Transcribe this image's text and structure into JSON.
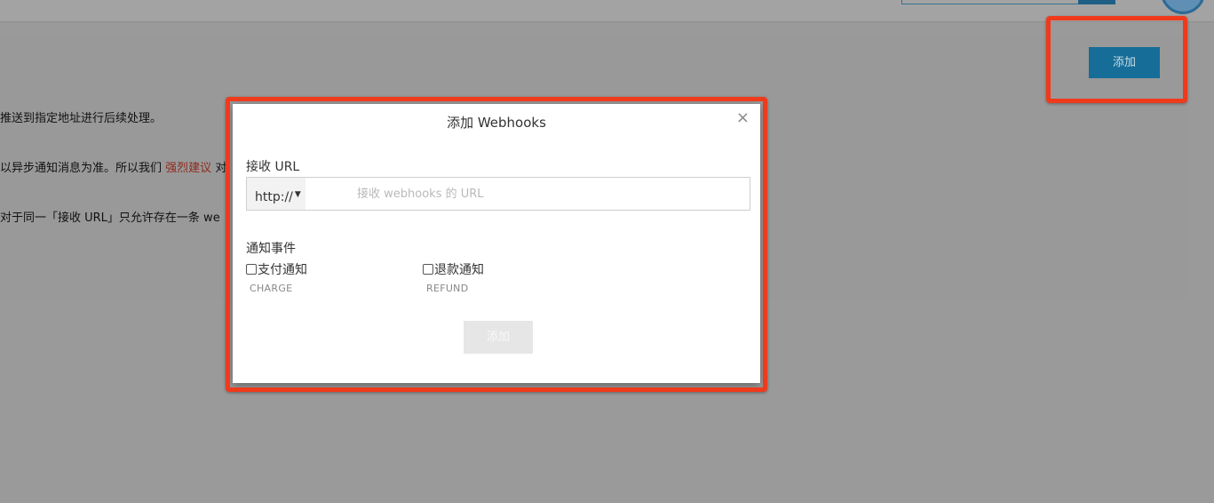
{
  "background": {
    "add_button_label": "添加",
    "paragraph_1": "推送到指定地址进行后续处理。",
    "paragraph_2_prefix": "以异步通知消息为准。所以我们",
    "paragraph_2_highlight": "强烈建议",
    "paragraph_2_suffix": "对",
    "paragraph_3": "对于同一「接收 URL」只允许存在一条 we"
  },
  "modal": {
    "title": "添加 Webhooks",
    "close_label": "×",
    "url_label": "接收 URL",
    "protocol_value": "http://",
    "url_placeholder": "接收 webhooks 的 URL",
    "events_label": "通知事件",
    "events": [
      {
        "label": "支付通知",
        "code": "CHARGE"
      },
      {
        "label": "退款通知",
        "code": "REFUND"
      }
    ],
    "submit_label": "添加"
  },
  "colors": {
    "highlight_border": "#ef3a1c",
    "primary_button": "#156d98",
    "accent_text": "#8e2a1a"
  }
}
